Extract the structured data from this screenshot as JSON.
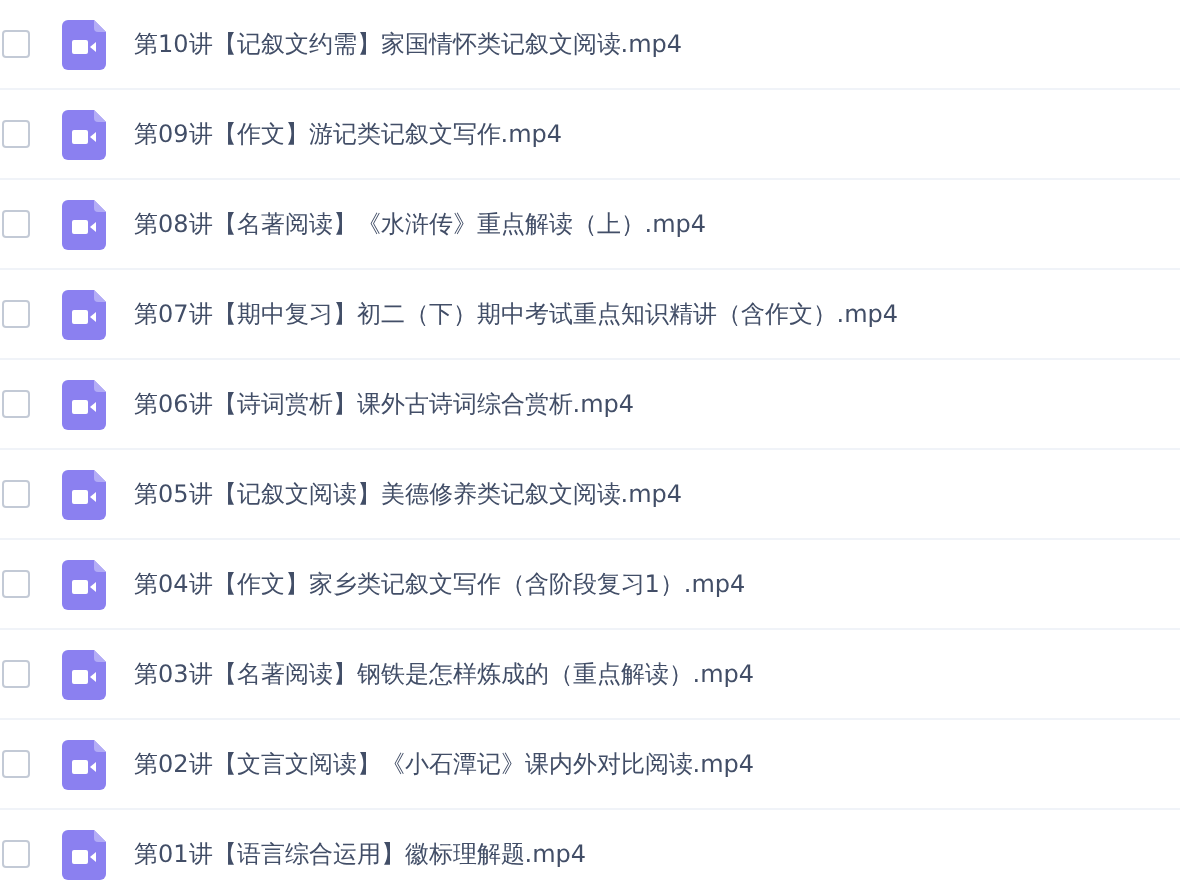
{
  "files": [
    {
      "name": "第10讲【记叙文约需】家国情怀类记叙文阅读.mp4",
      "checked": false
    },
    {
      "name": "第09讲【作文】游记类记叙文写作.mp4",
      "checked": false
    },
    {
      "name": "第08讲【名著阅读】《水浒传》重点解读（上）.mp4",
      "checked": false
    },
    {
      "name": "第07讲【期中复习】初二（下）期中考试重点知识精讲（含作文）.mp4",
      "checked": false
    },
    {
      "name": "第06讲【诗词赏析】课外古诗词综合赏析.mp4",
      "checked": false
    },
    {
      "name": "第05讲【记叙文阅读】美德修养类记叙文阅读.mp4",
      "checked": false
    },
    {
      "name": "第04讲【作文】家乡类记叙文写作（含阶段复习1）.mp4",
      "checked": false
    },
    {
      "name": "第03讲【名著阅读】钢铁是怎样炼成的（重点解读）.mp4",
      "checked": false
    },
    {
      "name": "第02讲【文言文阅读】《小石潭记》课内外对比阅读.mp4",
      "checked": false
    },
    {
      "name": "第01讲【语言综合运用】徽标理解题.mp4",
      "checked": false
    }
  ]
}
